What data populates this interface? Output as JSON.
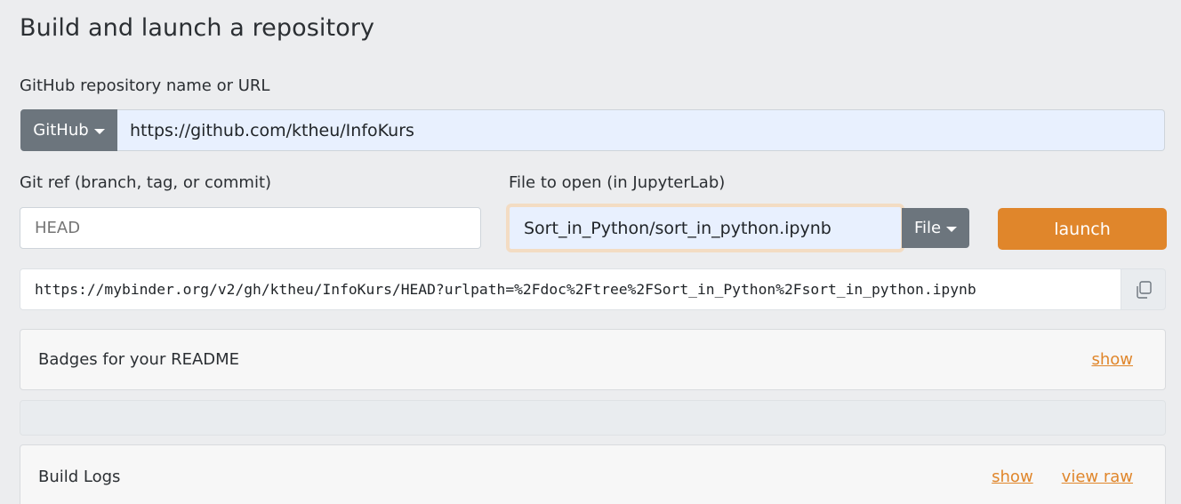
{
  "page": {
    "title": "Build and launch a repository"
  },
  "repo": {
    "label": "GitHub repository name or URL",
    "provider": "GitHub",
    "value": "https://github.com/ktheu/InfoKurs"
  },
  "ref": {
    "label": "Git ref (branch, tag, or commit)",
    "placeholder": "HEAD"
  },
  "file": {
    "label": "File to open (in JupyterLab)",
    "value": "Sort_in_Python/sort_in_python.ipynb",
    "type": "File"
  },
  "launch": {
    "label": "launch"
  },
  "binder_url": {
    "value": "https://mybinder.org/v2/gh/ktheu/InfoKurs/HEAD?urlpath=%2Fdoc%2Ftree%2FSort_in_Python%2Fsort_in_python.ipynb",
    "copy_icon": "copy-icon"
  },
  "badges": {
    "title": "Badges for your README",
    "show": "show"
  },
  "build_logs": {
    "title": "Build Logs",
    "show": "show",
    "view_raw": "view raw"
  },
  "colors": {
    "accent": "#e0862b",
    "secondary": "#6c757d",
    "autofill": "#e8f0fe"
  }
}
